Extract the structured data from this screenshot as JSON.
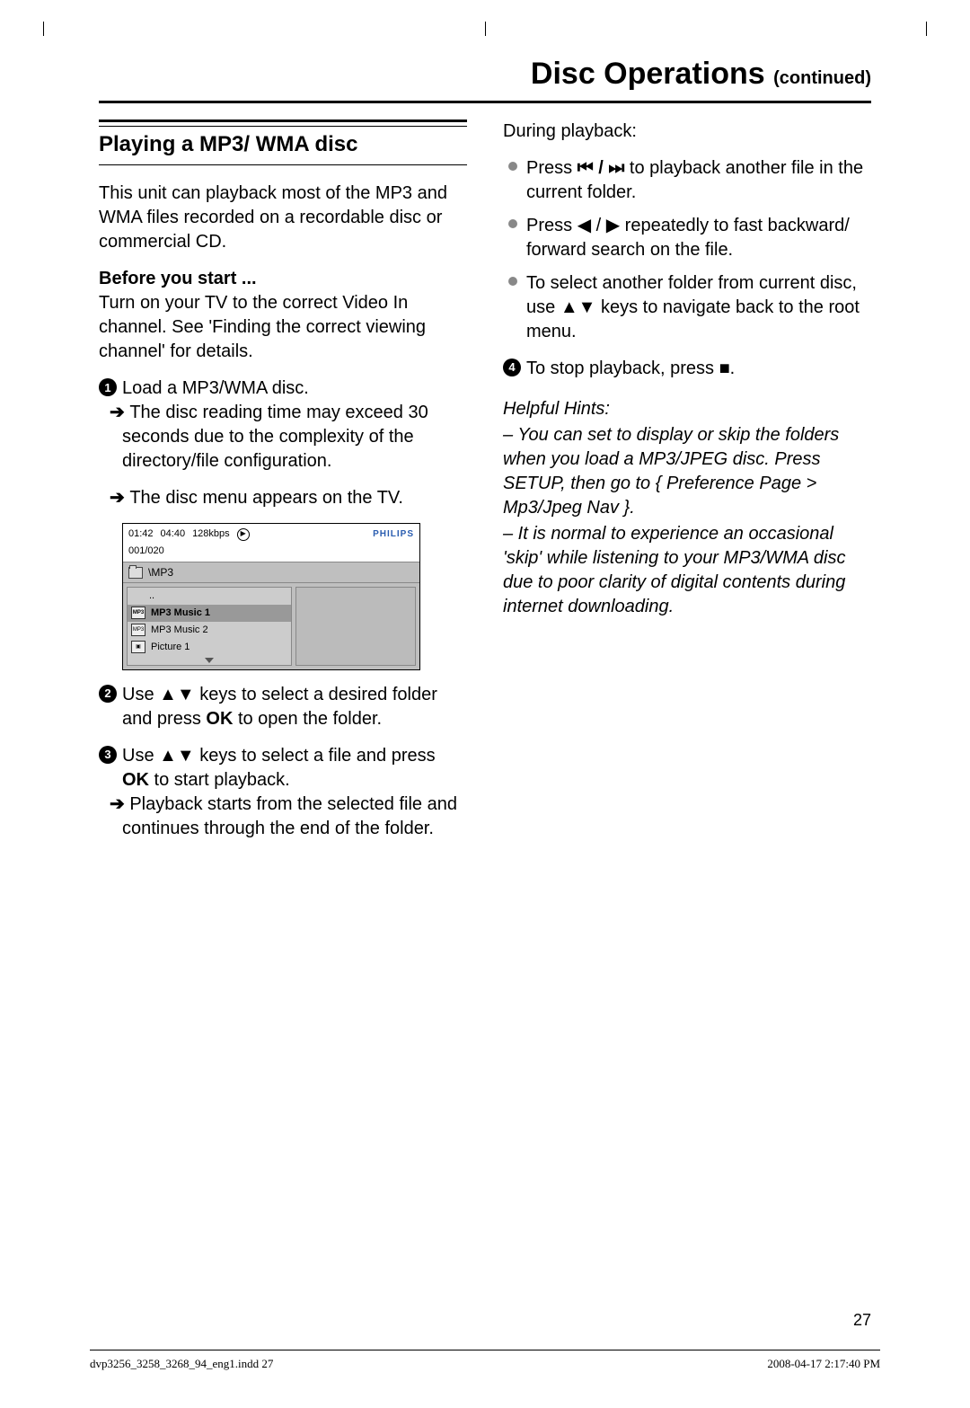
{
  "header": {
    "title": "Disc Operations",
    "continued": "(continued)"
  },
  "section": {
    "title": "Playing a MP3/ WMA disc"
  },
  "intro": "This unit can playback most of the MP3 and WMA files recorded on a recordable disc or commercial CD.",
  "before": {
    "head": "Before you start ...",
    "text": "Turn on your TV to the correct Video In channel. See 'Finding the correct viewing channel' for details."
  },
  "steps": {
    "s1": "Load a MP3/WMA disc.",
    "s1a": "The disc reading time may exceed 30 seconds due to the complexity of the directory/file configuration.",
    "s1b": "The disc menu appears on the TV.",
    "s2a": "Use ",
    "s2b": " keys to select a desired folder and press ",
    "s2c": " to open the folder.",
    "s3a": "Use ",
    "s3b": " keys to select a file and press ",
    "s3c": " to start playback.",
    "s3d": "Playback starts from the selected file and continues through the end of the folder.",
    "ok": "OK"
  },
  "during": {
    "head": "During playback:",
    "b1a": "Press  ",
    "b1b": "  to playback another file in the current folder.",
    "b2a": "Press ",
    "b2b": " repeatedly to fast backward/ forward search on the file.",
    "b3a": "To select another folder from current disc, use ",
    "b3b": " keys to navigate back to the root menu.",
    "s4a": "To stop playback, press ",
    "s4b": "."
  },
  "hints": {
    "head": "Helpful Hints:",
    "h1": "–  You can set to display or skip the folders when you load a MP3/JPEG disc. Press SETUP, then go to { Preference Page > Mp3/Jpeg Nav }.",
    "h2": "–  It is normal to experience an occasional 'skip' while listening to your MP3/WMA disc due to poor clarity of digital contents during internet downloading."
  },
  "diagram": {
    "time1": "01:42",
    "time2": "04:40",
    "bitrate": "128kbps",
    "track": "001/020",
    "brand": "PHILIPS",
    "path": "\\MP3",
    "rows": {
      "r0": "..",
      "r1": "MP3 Music 1",
      "r2": "MP3 Music 2",
      "r3": "Picture 1"
    }
  },
  "page": "27",
  "footer": {
    "left": "dvp3256_3258_3268_94_eng1.indd   27",
    "right": "2008-04-17   2:17:40 PM"
  }
}
